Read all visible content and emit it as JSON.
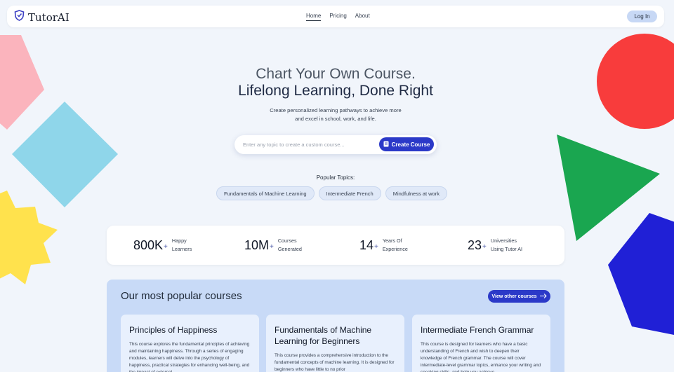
{
  "brand": {
    "name": "TutorAI",
    "logo_icon": "shield-logo-icon",
    "accent": "#3b3fc4"
  },
  "nav": {
    "links": [
      {
        "label": "Home",
        "active": true
      },
      {
        "label": "Pricing",
        "active": false
      },
      {
        "label": "About",
        "active": false
      }
    ],
    "login_label": "Log In"
  },
  "hero": {
    "title_line1": "Chart Your Own Course.",
    "title_line2": "Lifelong Learning, Done Right",
    "subtitle_line1": "Create personalized learning pathways to achieve more",
    "subtitle_line2": "and excel in school, work, and life."
  },
  "search": {
    "placeholder": "Enter any topic to create a custom course...",
    "value": "",
    "button_label": "Create Course",
    "button_icon": "book-icon"
  },
  "popular_topics": {
    "label": "Popular Topics:",
    "items": [
      "Fundamentals of Machine Learning",
      "Intermediate French",
      "Mindfulness at work"
    ]
  },
  "stats": [
    {
      "number": "800K",
      "plus": "+",
      "label_line1": "Happy",
      "label_line2": "Learners"
    },
    {
      "number": "10M",
      "plus": "+",
      "label_line1": "Courses",
      "label_line2": "Generated"
    },
    {
      "number": "14",
      "plus": "+",
      "label_line1": "Years Of",
      "label_line2": "Experience"
    },
    {
      "number": "23",
      "plus": "+",
      "label_line1": "Universities",
      "label_line2": "Using Tutor AI"
    }
  ],
  "popular_courses": {
    "title": "Our most popular courses",
    "view_label": "View other courses",
    "view_icon": "arrow-right-icon",
    "cards": [
      {
        "title": "Principles of Happiness",
        "description": "This course explores the fundamental principles of achieving and maintaining happiness. Through a series of engaging modules, learners will delve into the psychology of happiness, practical strategies for enhancing well-being, and the impact of external"
      },
      {
        "title": "Fundamentals of Machine Learning for Beginners",
        "description": "This course provides a comprehensive introduction to the fundamental concepts of machine learning. It is designed for beginners who have little to no prior"
      },
      {
        "title": "Intermediate French Grammar",
        "description": "This course is designed for learners who have a basic understanding of French and wish to deepen their knowledge of French grammar. The course will cover intermediate-level grammar topics, enhance your writing and speaking skills, and help you achieve"
      }
    ]
  },
  "colors": {
    "background": "#f1f5fb",
    "primary_button": "#2b39c8",
    "shape_pink": "#fbb4bd",
    "shape_cyan": "#8fd6ea",
    "shape_yellow": "#ffe24d",
    "shape_red": "#f83c3c",
    "shape_green": "#1aa650",
    "shape_blue": "#2020d6"
  }
}
